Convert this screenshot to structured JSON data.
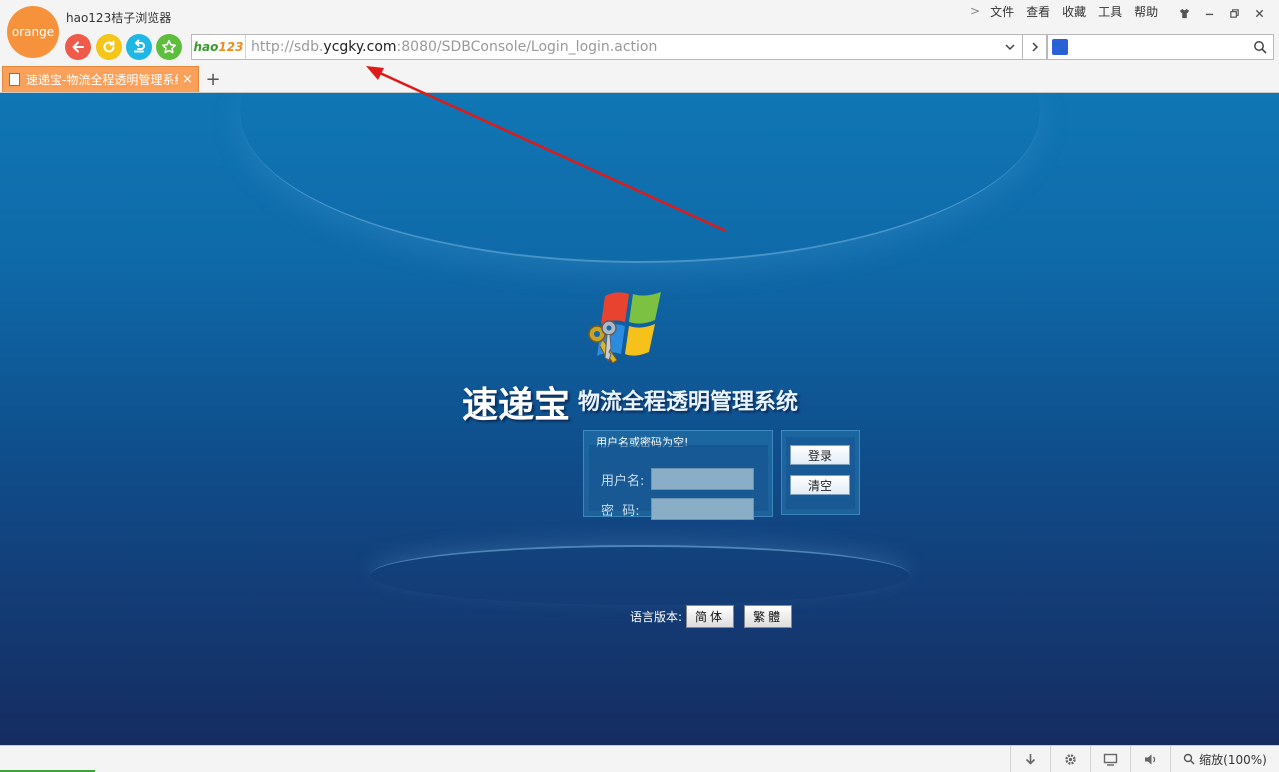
{
  "browser": {
    "logo_text": "orange",
    "app_title": "hao123桔子浏览器",
    "menu": [
      "文件",
      "查看",
      "收藏",
      "工具",
      "帮助"
    ],
    "address": {
      "badge_h": "hao",
      "badge_n": "123",
      "url_prefix": "http://sdb.",
      "url_domain": "ycgky.com",
      "url_suffix": ":8080/SDBConsole/Login_login.action"
    },
    "search_engine_glyph": "🐾",
    "tab": {
      "label": "速递宝-物流全程透明管理系统",
      "close": "×"
    },
    "new_tab": "+",
    "zoom": "缩放(100%)"
  },
  "page": {
    "brand_big": "速递宝",
    "brand_small": "物流全程透明管理系统",
    "login_message": "用户名或密码为空!",
    "username_label": "用户名:",
    "password_label": "密  码:",
    "login_button": "登录",
    "clear_button": "清空",
    "language_label": "语言版本:",
    "lang_simplified": "简体",
    "lang_traditional": "繁體"
  },
  "icons": {
    "back": "arrow-left-icon",
    "refresh": "refresh-icon",
    "restore": "undo-icon",
    "favorite": "star-icon",
    "search": "search-icon",
    "download": "download-icon",
    "settings": "gear-icon",
    "screen": "screen-icon",
    "sound": "speaker-icon"
  },
  "colors": {
    "tab_active": "#f9a05b",
    "annotation_arrow": "#e01919",
    "page_bg_top": "#1076b4",
    "page_bg_bottom": "#152c61"
  }
}
